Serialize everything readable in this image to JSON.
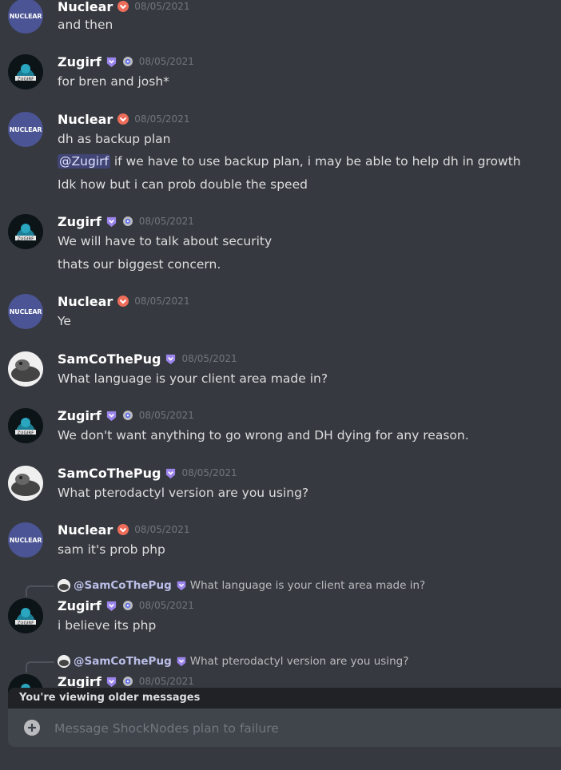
{
  "channel": {
    "placeholder": "Message ShockNodes plan to failure",
    "older_notice": "You're viewing older messages"
  },
  "avatars": {
    "nuclear": "NUCLEAR",
    "zugirf": "ZUGIRF"
  },
  "messages": [
    {
      "author": "Nuclear",
      "timestamp": "08/05/2021",
      "lines": [
        "and then"
      ]
    },
    {
      "author": "Zugirf",
      "timestamp": "08/05/2021",
      "lines": [
        "for bren and josh*"
      ]
    },
    {
      "author": "Nuclear",
      "timestamp": "08/05/2021",
      "lines": [
        "dh as backup plan",
        "if we have to use backup plan, i may be able to help dh in growth",
        "Idk how but i can prob double the speed"
      ],
      "mention": "@Zugirf"
    },
    {
      "author": "Zugirf",
      "timestamp": "08/05/2021",
      "lines": [
        "We will have to talk about security",
        "thats our biggest concern."
      ]
    },
    {
      "author": "Nuclear",
      "timestamp": "08/05/2021",
      "lines": [
        "Ye"
      ]
    },
    {
      "author": "SamCoThePug",
      "timestamp": "08/05/2021",
      "lines": [
        "What language is your client area made in?"
      ]
    },
    {
      "author": "Zugirf",
      "timestamp": "08/05/2021",
      "lines": [
        "We don't want anything to go wrong and DH dying for any reason."
      ]
    },
    {
      "author": "SamCoThePug",
      "timestamp": "08/05/2021",
      "lines": [
        "What pterodactyl version are you using?"
      ]
    },
    {
      "author": "Nuclear",
      "timestamp": "08/05/2021",
      "lines": [
        "sam it's prob php"
      ]
    },
    {
      "author": "Zugirf",
      "timestamp": "08/05/2021",
      "lines": [
        "i believe its php"
      ],
      "reply": {
        "user": "@SamCoThePug",
        "text": "What language is your client area made in?"
      }
    },
    {
      "author": "Zugirf",
      "timestamp": "08/05/2021",
      "lines": [],
      "reply": {
        "user": "@SamCoThePug",
        "text": "What pterodactyl version are you using?"
      }
    }
  ],
  "colors": {
    "background": "#36393f",
    "nitro_badge": "#ed6c5a",
    "booster_badge": "#9b84ec",
    "mention_bg": "#4b5294"
  }
}
